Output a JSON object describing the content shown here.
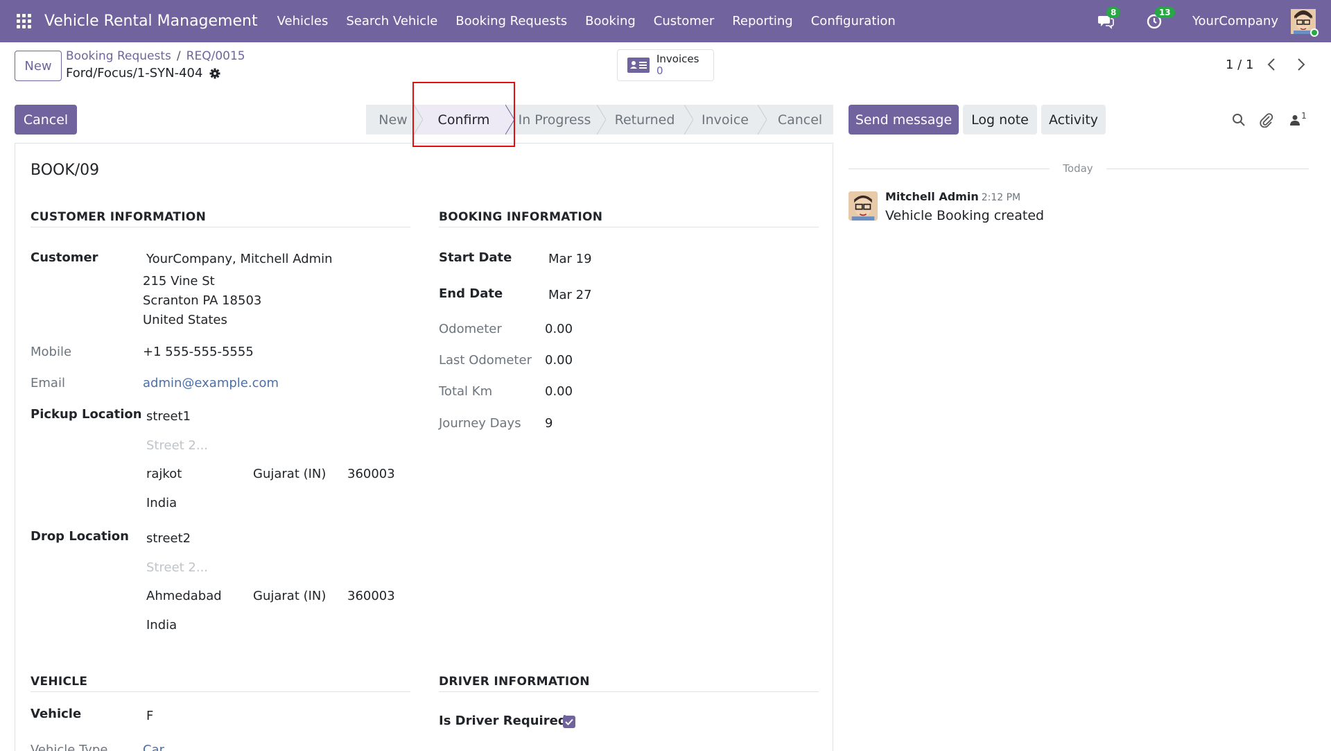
{
  "navbar": {
    "app_title": "Vehicle Rental Management",
    "menu": [
      "Vehicles",
      "Search Vehicle",
      "Booking Requests",
      "Booking",
      "Customer",
      "Reporting",
      "Configuration"
    ],
    "messages_count": "8",
    "activities_count": "13",
    "company": "YourCompany",
    "bg_color": "#71639e"
  },
  "control_panel": {
    "new_label": "New",
    "breadcrumb": [
      "Booking Requests",
      "REQ/0015"
    ],
    "breadcrumb_sep": "/",
    "record_name": "Ford/Focus/1-SYN-404",
    "smart_button": {
      "label": "Invoices",
      "count": "0"
    },
    "pager": "1 / 1"
  },
  "status": {
    "cancel_label": "Cancel",
    "stages": [
      "New",
      "Confirm",
      "In Progress",
      "Returned",
      "Invoice",
      "Cancel"
    ],
    "active_stage": "Confirm"
  },
  "form": {
    "title": "BOOK/09",
    "customer_section": "CUSTOMER INFORMATION",
    "booking_section": "BOOKING INFORMATION",
    "customer_label": "Customer",
    "customer_name": "YourCompany, Mitchell Admin",
    "customer_address": [
      "215 Vine St",
      "Scranton PA 18503",
      "United States"
    ],
    "mobile_label": "Mobile",
    "mobile": "+1 555-555-5555",
    "email_label": "Email",
    "email": "admin@example.com",
    "pickup_label": "Pickup Location",
    "pickup": {
      "street": "street1",
      "street2_placeholder": "Street 2...",
      "city": "rajkot",
      "state": "Gujarat (IN)",
      "zip": "360003",
      "country": "India"
    },
    "drop_label": "Drop Location",
    "drop": {
      "street": "street2",
      "street2_placeholder": "Street 2...",
      "city": "Ahmedabad",
      "state": "Gujarat (IN)",
      "zip": "360003",
      "country": "India"
    },
    "start_date_label": "Start Date",
    "start_date": "Mar 19",
    "end_date_label": "End Date",
    "end_date": "Mar 27",
    "odometer_label": "Odometer",
    "odometer": "0.00",
    "last_odometer_label": "Last Odometer",
    "last_odometer": "0.00",
    "total_km_label": "Total Km",
    "total_km": "0.00",
    "journey_days_label": "Journey Days",
    "journey_days": "9",
    "vehicle_section": "VEHICLE",
    "vehicle_label": "Vehicle",
    "vehicle": "F",
    "vehicle_type_label": "Vehicle Type",
    "vehicle_type": "Car",
    "driver_section": "DRIVER INFORMATION",
    "driver_required_label": "Is Driver Required",
    "driver_required": true
  },
  "chatter": {
    "send_message": "Send message",
    "log_note": "Log note",
    "activity": "Activity",
    "followers_count": "1",
    "date_separator": "Today",
    "messages": [
      {
        "author": "Mitchell Admin",
        "time": "2:12 PM",
        "body": "Vehicle Booking created"
      }
    ]
  }
}
